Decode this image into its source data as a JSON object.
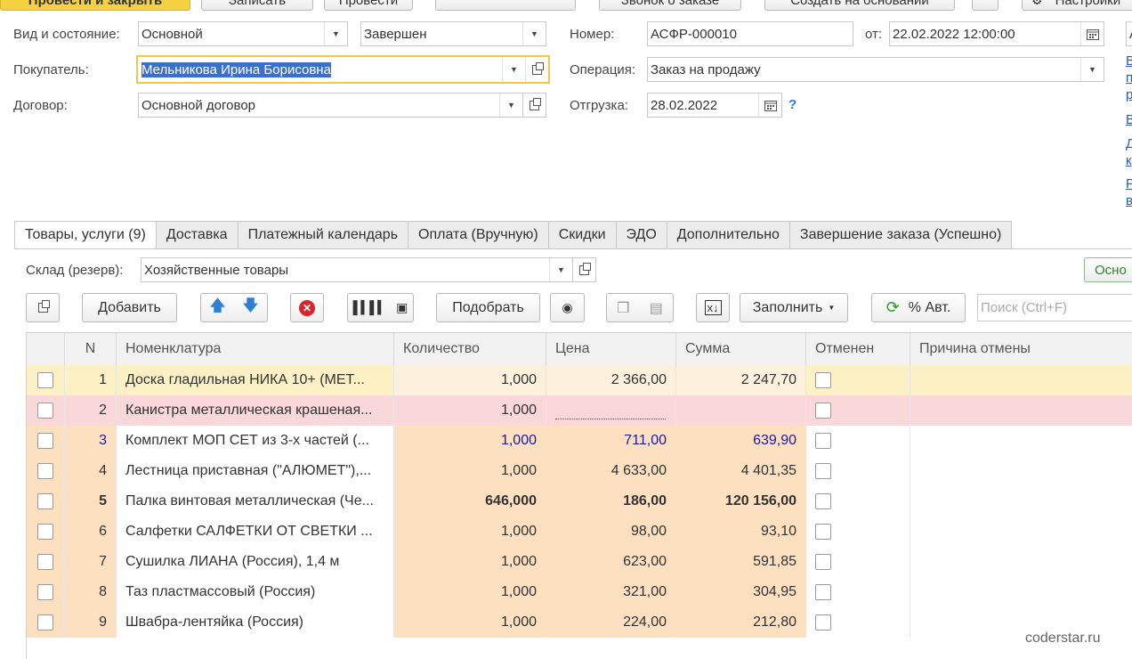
{
  "toolbar_top": {
    "post_close": "Провести и закрыть",
    "save": "Записать",
    "post": "Провести",
    "order_info": "Звонок о заказе",
    "create_based": "Создать на основании",
    "settings": "Настройки"
  },
  "header": {
    "kind_state_label": "Вид и состояние:",
    "kind_value": "Основной",
    "state_value": "Завершен",
    "buyer_label": "Покупатель:",
    "buyer_value": "Мельникова Ирина Борисовна",
    "contract_label": "Договор:",
    "contract_value": "Основной договор",
    "number_label": "Номер:",
    "number_value": "АСФР-000010",
    "date_label": "от:",
    "date_value": "22.02.2022 12:00:00",
    "operation_label": "Операция:",
    "operation_value": "Заказ на продажу",
    "shipment_label": "Отгрузка:",
    "shipment_value": "28.02.2022",
    "help": "?"
  },
  "tabs": [
    {
      "label": "Товары, услуги (9)",
      "active": true
    },
    {
      "label": "Доставка"
    },
    {
      "label": "Платежный календарь"
    },
    {
      "label": "Оплата (Вручную)"
    },
    {
      "label": "Скидки"
    },
    {
      "label": "ЭДО"
    },
    {
      "label": "Дополнительно"
    },
    {
      "label": "Завершение заказа (Успешно)"
    }
  ],
  "warehouse": {
    "label": "Склад (резерв):",
    "value": "Хозяйственные товары",
    "right_button": "Осно"
  },
  "grid_toolbar": {
    "add": "Добавить",
    "pick": "Подобрать",
    "fill": "Заполнить",
    "auto_percent": "% Авт.",
    "search_placeholder": "Поиск (Ctrl+F)"
  },
  "columns": {
    "n": "N",
    "item": "Номенклатура",
    "qty": "Количество",
    "price": "Цена",
    "sum": "Сумма",
    "cancelled": "Отменен",
    "reason": "Причина отмены"
  },
  "rows": [
    {
      "n": "1",
      "item": "Доска гладильная  НИКА 10+ (МЕТ...",
      "qty": "1,000",
      "price": "2 366,00",
      "sum": "2 247,70",
      "style": "selected"
    },
    {
      "n": "2",
      "item": "Канистра металлическая крашеная...",
      "qty": "1,000",
      "price": "",
      "sum": "",
      "style": "error"
    },
    {
      "n": "3",
      "item": "Комплект МОП СЕТ из 3-х частей (...",
      "qty": "1,000",
      "price": "711,00",
      "sum": "639,90",
      "style": "blue"
    },
    {
      "n": "4",
      "item": "Лестница приставная (\"АЛЮМЕТ\"),...",
      "qty": "1,000",
      "price": "4 633,00",
      "sum": "4 401,35",
      "style": "normal"
    },
    {
      "n": "5",
      "item": "Палка винтовая металлическая (Че...",
      "qty": "646,000",
      "price": "186,00",
      "sum": "120 156,00",
      "style": "bold"
    },
    {
      "n": "6",
      "item": "Салфетки САЛФЕТКИ ОТ СВЕТКИ ...",
      "qty": "1,000",
      "price": "98,00",
      "sum": "93,10",
      "style": "normal"
    },
    {
      "n": "7",
      "item": "Сушилка ЛИАНА (Россия), 1,4 м",
      "qty": "1,000",
      "price": "623,00",
      "sum": "591,85",
      "style": "normal"
    },
    {
      "n": "8",
      "item": "Таз пластмассовый (Россия)",
      "qty": "1,000",
      "price": "321,00",
      "sum": "304,95",
      "style": "normal"
    },
    {
      "n": "9",
      "item": "Швабра-лентяйка (Россия)",
      "qty": "1,000",
      "price": "224,00",
      "sum": "212,80",
      "style": "normal"
    }
  ],
  "right_links": [
    "В",
    "п",
    "р",
    "В",
    "Д",
    "к",
    "Р",
    "в"
  ],
  "watermark": "coderstar.ru",
  "colors": {
    "accent_yellow": "#f7d64a",
    "row_peach": "#fde0c0",
    "row_selected": "#fbf1c5",
    "row_error": "#fad7d9",
    "link_blue": "#2a5db0"
  }
}
